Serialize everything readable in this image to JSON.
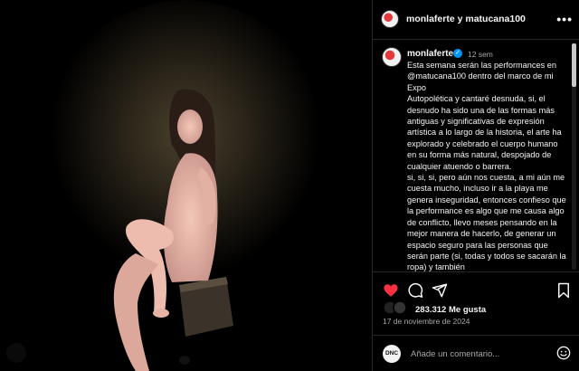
{
  "post": {
    "header_title": "monlaferte y matucana100",
    "username": "monlaferte",
    "age": "12 sem",
    "caption_paragraphs": [
      "Esta semana serán las performances en @matucana100 dentro del marco de mi Expo",
      "Autopolética y cantaré desnuda, si, el desnudo ha sido una de las formas más antiguas y significativas de expresión artística a lo largo de la historia, el arte ha explorado y celebrado el cuerpo humano en su forma más natural, despojado de cualquier atuendo o barrera.",
      "si, si, si, pero aún nos cuesta, a mi aún me cuesta mucho, incluso ir a la playa me genera inseguridad, entonces confieso que la performance es algo que me causa algo de conflicto, llevo meses pensando en la mejor manera de hacerlo, de generar un espacio seguro para las personas que serán parte (si, todas y todos se sacarán la ropa) y también"
    ],
    "likes_text": "283.312 Me gusta",
    "date": "17 de noviembre de 2024",
    "comment_placeholder": "Añade un comentario...",
    "commenter_avatar_text": "DNC"
  },
  "icons": {
    "more": "more-horizontal-icon",
    "like": "heart-filled-icon",
    "comment": "comment-icon",
    "share": "send-icon",
    "save": "bookmark-icon",
    "emoji": "emoji-icon",
    "verified": "verified-badge-icon"
  },
  "colors": {
    "background": "#000000",
    "text": "#f5f5f5",
    "secondary_text": "#a8a8a8",
    "like_red": "#ff3040",
    "verified_blue": "#0095f6",
    "divider": "#262626"
  }
}
